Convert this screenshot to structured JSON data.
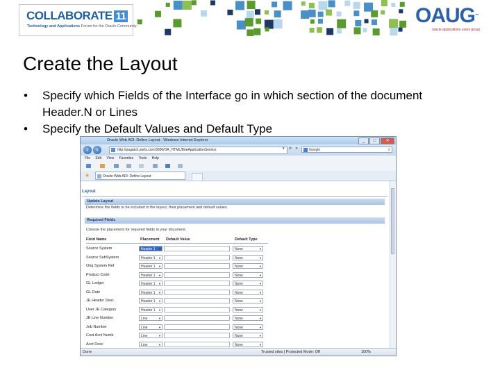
{
  "slide": {
    "logo": {
      "title": "COLLABORATE",
      "number": "11",
      "tagline_bold": "Technology and Applications",
      "tagline_rest": "Forum for the Oracle Community"
    },
    "oaug": {
      "name": "OAUG",
      "tm": "™",
      "tagline": "oracle applications users group"
    },
    "title": "Create the Layout",
    "bullets": [
      "Specify which Fields of the Interface go in which section of the document Header.N or Lines",
      "Specify the Default Values and Default Type"
    ],
    "colors": {
      "brand_blue": "#2b61a8",
      "mosaic_green": "#5a9a2e",
      "mosaic_navy": "#1e3a64",
      "mosaic_sky": "#4a90c8"
    }
  },
  "browser": {
    "window_title": "Oracle Web ADI: Define Layout - Windows Internet Explorer",
    "url": "http://pagatch.ports.com:8000/OA_HTML/BneApplicationService",
    "search_engine": "Google",
    "menu": [
      "File",
      "Edit",
      "View",
      "Favorites",
      "Tools",
      "Help"
    ],
    "tab_title": "Oracle Web ADI: Define Layout",
    "status_done": "Done",
    "status_zone": "Trusted sites | Protected Mode: Off",
    "zoom": "100%"
  },
  "page": {
    "heading": "Layout",
    "section1_title": "Update Layout",
    "section1_desc": "Determine the fields to be included in the layout, their placement and default values.",
    "section2_title": "Required Fields",
    "section2_desc": "Choose the placement for required fields in your document.",
    "columns": [
      "Field Name",
      "Placement",
      "Default Value",
      "Default Type"
    ],
    "rows": [
      {
        "field": "Source System",
        "placement": "Header 1",
        "default_type": "None",
        "selected": true
      },
      {
        "field": "Source SubSystem",
        "placement": "Header 1",
        "default_type": "None"
      },
      {
        "field": "Orig System Ref",
        "placement": "Header 1",
        "default_type": "None"
      },
      {
        "field": "Product Code",
        "placement": "Header 1",
        "default_type": "None"
      },
      {
        "field": "GL Ledger",
        "placement": "Header 1",
        "default_type": "None"
      },
      {
        "field": "GL Date",
        "placement": "Header 1",
        "default_type": "None"
      },
      {
        "field": "JE Header Desc",
        "placement": "Header 1",
        "default_type": "None"
      },
      {
        "field": "User JE Category",
        "placement": "Header 1",
        "default_type": "None"
      },
      {
        "field": "JE Line Number",
        "placement": "Line",
        "default_type": "None"
      },
      {
        "field": "Job Number",
        "placement": "Line",
        "default_type": "None"
      },
      {
        "field": "Cost Acct Numb",
        "placement": "Line",
        "default_type": "None"
      },
      {
        "field": "Acct Desc",
        "placement": "Line",
        "default_type": "None"
      }
    ]
  }
}
